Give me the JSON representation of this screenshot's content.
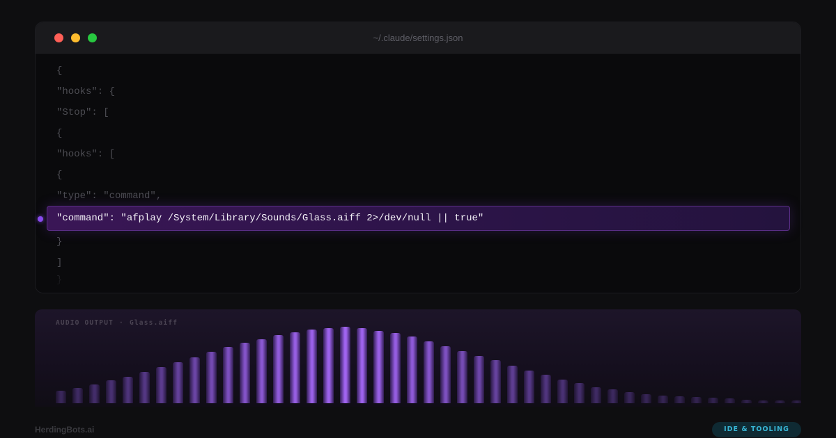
{
  "window": {
    "title": "~/.claude/settings.json",
    "controls": [
      "close",
      "minimize",
      "maximize"
    ]
  },
  "code": {
    "lines": [
      "{",
      "\"hooks\": {",
      "\"Stop\": [",
      "{",
      "\"hooks\": [",
      "{",
      "\"type\": \"command\","
    ],
    "highlighted_line": "\"command\": \"afplay /System/Library/Sounds/Glass.aiff 2>/dev/null || true\"",
    "after_lines": [
      "}",
      "]",
      "}"
    ]
  },
  "audio": {
    "label": "AUDIO OUTPUT",
    "separator": "·",
    "file": "Glass.aiff",
    "levels": [
      0.16,
      0.2,
      0.25,
      0.3,
      0.35,
      0.41,
      0.47,
      0.54,
      0.6,
      0.67,
      0.74,
      0.79,
      0.84,
      0.89,
      0.93,
      0.96,
      0.98,
      1.0,
      0.98,
      0.95,
      0.92,
      0.87,
      0.81,
      0.75,
      0.68,
      0.62,
      0.56,
      0.49,
      0.43,
      0.37,
      0.31,
      0.26,
      0.21,
      0.18,
      0.15,
      0.12,
      0.1,
      0.09,
      0.08,
      0.07,
      0.06,
      0.05,
      0.04,
      0.03,
      0.02
    ]
  },
  "footer": {
    "brand": "HerdingBots.ai",
    "badge": "IDE & TOOLING"
  },
  "colors": {
    "highlight": "#3a1656",
    "accent": "#8a4cf0",
    "badge_text": "#38b6d6"
  }
}
